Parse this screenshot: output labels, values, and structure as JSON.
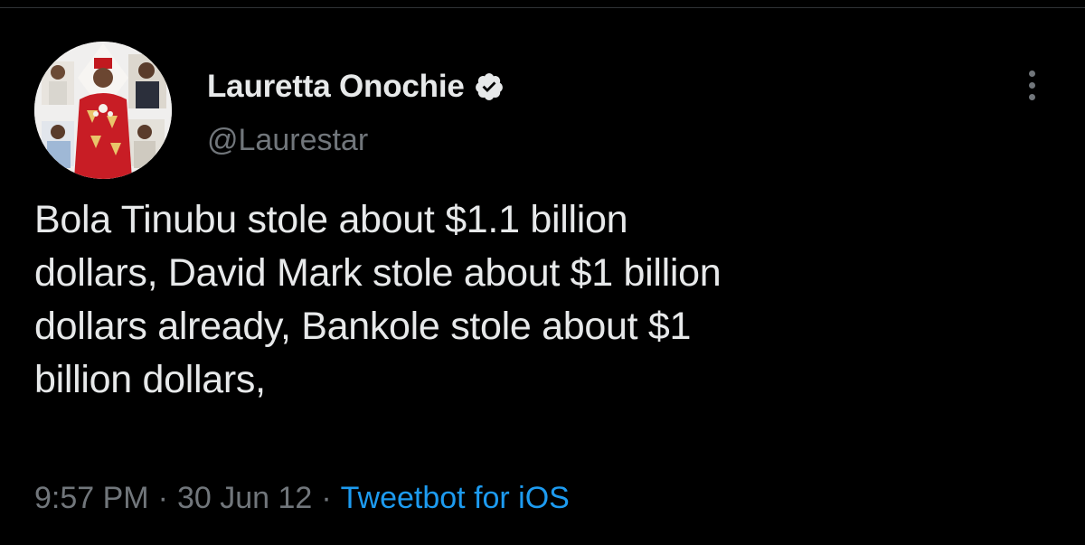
{
  "tweet": {
    "author": {
      "display_name": "Lauretta Onochie",
      "handle": "@Laurestar",
      "verified": true
    },
    "text": "Bola Tinubu stole about $1.1 billion\ndollars, David Mark stole about $1 billion\ndollars already, Bankole stole about $1\nbillion dollars,",
    "time": "9:57 PM",
    "separator": "·",
    "date": "30 Jun 12",
    "source": "Tweetbot for iOS"
  },
  "icons": {
    "verified": "verified-badge-icon",
    "more": "more-options-icon"
  },
  "colors": {
    "background": "#000000",
    "primary_text": "#e7e9ea",
    "secondary_text": "#71767b",
    "link": "#1d9bf0"
  }
}
